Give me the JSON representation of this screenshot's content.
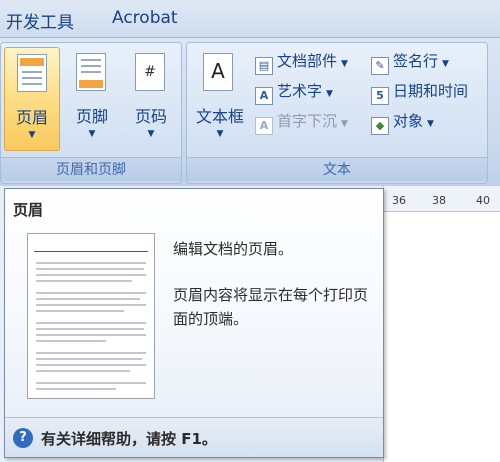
{
  "tabs": [
    "开发工具",
    "Acrobat"
  ],
  "groups": {
    "header_footer": {
      "label": "页眉和页脚",
      "buttons": [
        {
          "label": "页眉",
          "icon": "header-icon"
        },
        {
          "label": "页脚",
          "icon": "footer-icon"
        },
        {
          "label": "页码",
          "icon": "page-number-icon"
        }
      ]
    },
    "text": {
      "label": "文本",
      "textbox": {
        "label": "文本框",
        "icon": "textbox-icon"
      },
      "col1": [
        {
          "label": "文档部件",
          "icon": "quick-parts-icon",
          "glyph": "▤",
          "disabled": false
        },
        {
          "label": "艺术字",
          "icon": "wordart-icon",
          "glyph": "A",
          "disabled": false
        },
        {
          "label": "首字下沉",
          "icon": "dropcap-icon",
          "glyph": "A",
          "disabled": true
        }
      ],
      "col2": [
        {
          "label": "签名行",
          "icon": "signature-line-icon",
          "glyph": "✎",
          "disabled": false
        },
        {
          "label": "日期和时间",
          "icon": "date-time-icon",
          "glyph": "5",
          "disabled": false
        },
        {
          "label": "对象",
          "icon": "object-icon",
          "glyph": "◆",
          "disabled": false
        }
      ]
    }
  },
  "ruler": [
    "36",
    "38",
    "40"
  ],
  "tooltip": {
    "title": "页眉",
    "desc1": "编辑文档的页眉。",
    "desc2": "页眉内容将显示在每个打印页面的顶端。",
    "help": "有关详细帮助，请按 F1。"
  },
  "colors": {
    "accent": "#15428b",
    "active": "#f9c95c"
  }
}
